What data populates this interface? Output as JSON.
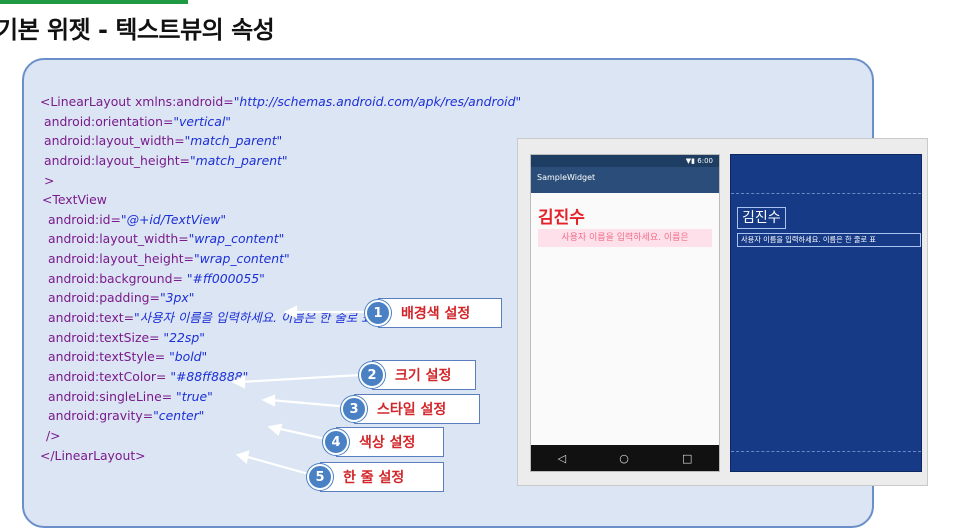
{
  "title": "기본 위젯 - 텍스트뷰의 속성",
  "code_lines": [
    [
      "<LinearLayout xmlns:android=",
      "\"http://schemas.android.com/apk/res/android\""
    ],
    [
      "android:orientation=",
      "\"vertical\""
    ],
    [
      "android:layout_width=",
      "\"match_parent\""
    ],
    [
      "android:layout_height=",
      "\"match_parent\""
    ],
    [
      ">",
      ""
    ],
    [
      "<TextView",
      ""
    ],
    [
      "android:id=",
      "\"@+id/TextView\""
    ],
    [
      "android:layout_width=",
      "\"wrap_content\""
    ],
    [
      "android:layout_height=",
      "\"wrap_content\""
    ],
    [
      "android:background= ",
      "\"#ff000055\""
    ],
    [
      "android:padding=",
      "\"3px\""
    ],
    [
      "android:text=",
      "\"사용자 이름을 입력하세요. 이름은 한 줄로 표시됩니다.\""
    ],
    [
      "android:textSize= ",
      "\"22sp\""
    ],
    [
      "android:textStyle= ",
      "\"bold\""
    ],
    [
      "android:textColor= ",
      "\"#88ff8888\""
    ],
    [
      "android:singleLine= ",
      "\"true\""
    ],
    [
      "android:gravity=",
      "\"center\""
    ],
    [
      "/>",
      ""
    ],
    [
      "</LinearLayout>",
      ""
    ]
  ],
  "callouts": [
    {
      "num": "1",
      "label": "배경색 설정"
    },
    {
      "num": "2",
      "label": "크기 설정"
    },
    {
      "num": "3",
      "label": "스타일 설정"
    },
    {
      "num": "4",
      "label": "색상 설정"
    },
    {
      "num": "5",
      "label": "한 줄 설정"
    }
  ],
  "phone": {
    "time": "6:00",
    "app_title": "SampleWidget",
    "name": "김진수",
    "text": "사용자 이름을 입력하세요. 이름은",
    "nav_back": "◁",
    "nav_home": "○",
    "nav_recent": "□"
  },
  "blueprint": {
    "name": "김진수",
    "text": "사용자 이름을 입력하세요. 이름은 한 줄로 표"
  },
  "colors": {
    "accent": "#1f9a43",
    "callout_red": "#d2262a",
    "badge_blue": "#4a80c4"
  }
}
